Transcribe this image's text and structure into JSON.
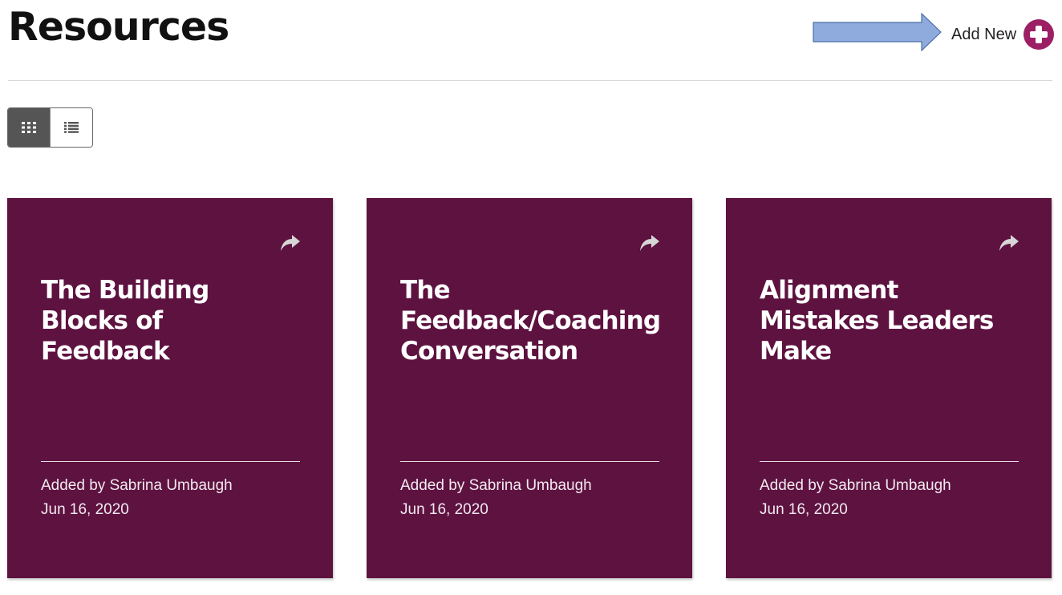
{
  "header": {
    "title": "Resources",
    "add_new_label": "Add New"
  },
  "view_toggle": {
    "active": "grid",
    "options": [
      "grid",
      "list"
    ]
  },
  "cards": [
    {
      "title": "The Building Blocks of Feedback",
      "author": "Added by Sabrina Umbaugh",
      "date": "Jun 16, 2020"
    },
    {
      "title": "The Feedback/Coaching Conversation",
      "author": "Added by Sabrina Umbaugh",
      "date": "Jun 16, 2020"
    },
    {
      "title": "Alignment Mistakes Leaders Make",
      "author": "Added by Sabrina Umbaugh",
      "date": "Jun 16, 2020"
    }
  ],
  "colors": {
    "card_background": "#5e1240",
    "accent": "#9c1f66",
    "annotation_arrow": "#8faadc"
  },
  "icons": [
    "arrow-annotation-icon",
    "plus-circle-icon",
    "grid-icon",
    "list-icon",
    "share-icon"
  ]
}
